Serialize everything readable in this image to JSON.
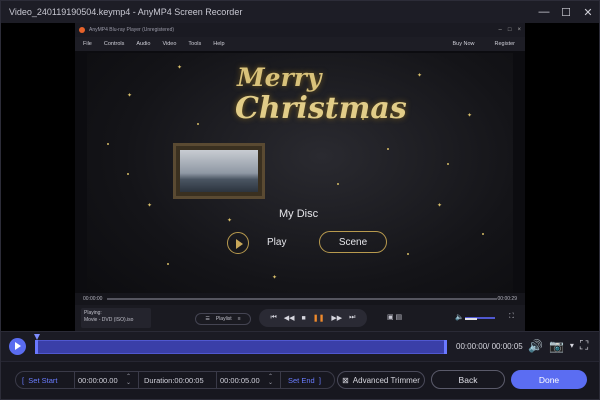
{
  "window": {
    "title": "Video_240119190504.keymp4  -  AnyMP4 Screen Recorder",
    "minimize": "—",
    "maximize": "☐",
    "close": "✕"
  },
  "player": {
    "title": "AnyMP4 Blu-ray Player (Unregistered)",
    "menu": [
      "File",
      "Controls",
      "Audio",
      "Video",
      "Tools",
      "Help"
    ],
    "buy_now": "Buy Now",
    "register": "Register",
    "greeting_line1": "Merry",
    "greeting_line2": "Christmas",
    "disc_title": "My Disc",
    "play_label": "Play",
    "scene_label": "Scene",
    "time_current": "00:00:00",
    "time_total": "00:00:29",
    "playing_label": "Playing:",
    "playing_file": "Movie - DVD (ISO).iso",
    "playlist_label": "Playlist",
    "volume_level": 0.4
  },
  "timeline": {
    "time_display": "00:00:00/ 00:00:05"
  },
  "trim": {
    "set_start": "Set Start",
    "start_time": "00:00:00.00",
    "duration": "Duration:00:00:05",
    "end_time": "00:00:05.00",
    "set_end": "Set End",
    "advanced_trimmer": "Advanced Trimmer",
    "back": "Back",
    "done": "Done"
  },
  "colors": {
    "accent": "#5b6df2",
    "track": "#3a3fa8",
    "gold": "#d9c27a"
  }
}
